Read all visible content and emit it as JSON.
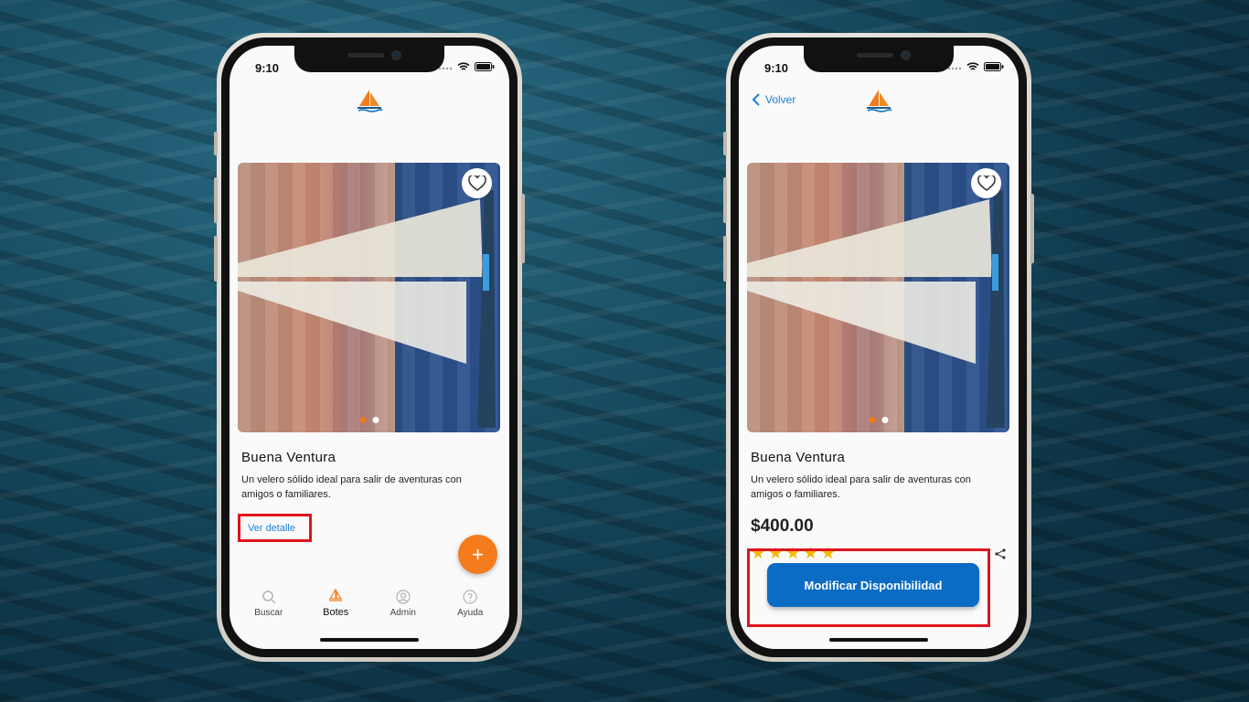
{
  "colors": {
    "accent": "#f47c1c",
    "link": "#1e7fd4",
    "primary_button": "#0b6cc4",
    "highlight_box": "#e0141e",
    "star": "#f5b800"
  },
  "phone_left": {
    "status_time": "9:10",
    "logo_icon": "sailboat-logo-icon",
    "card": {
      "title": "Buena Ventura",
      "description": "Un velero sólido ideal para salir de aventuras con amigos o familiares.",
      "link": "Ver detalle"
    },
    "fab_label": "+",
    "tabs": [
      {
        "label": "Buscar",
        "icon": "search-icon"
      },
      {
        "label": "Botes",
        "icon": "sailboat-icon"
      },
      {
        "label": "Admin",
        "icon": "user-icon"
      },
      {
        "label": "Ayuda",
        "icon": "help-icon"
      }
    ]
  },
  "phone_right": {
    "status_time": "9:10",
    "back_label": "Volver",
    "card": {
      "title": "Buena Ventura",
      "description": "Un velero sólido ideal para salir de aventuras con amigos o familiares.",
      "price": "$400.00",
      "rating": 5
    },
    "modify_button": "Modificar Disponibilidad"
  }
}
